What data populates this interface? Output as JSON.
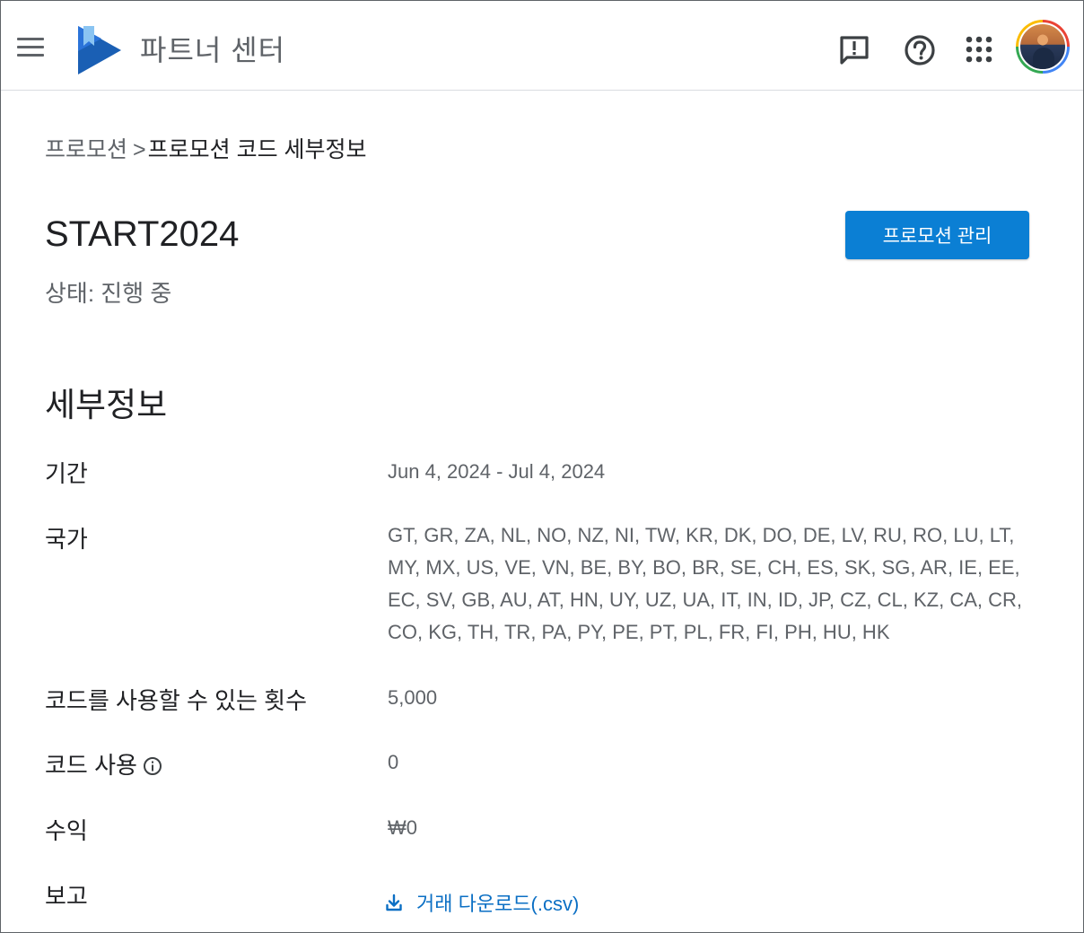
{
  "header": {
    "title": "파트너 센터",
    "icons": [
      "menu-icon",
      "play-books-logo",
      "feedback-icon",
      "help-icon",
      "apps-grid-icon",
      "avatar"
    ]
  },
  "breadcrumb": {
    "parent": "프로모션",
    "separator": ">",
    "current": "프로모션 코드 세부정보"
  },
  "promo": {
    "code": "START2024",
    "status": "상태: 진행 중",
    "manage_label": "프로모션 관리"
  },
  "details": {
    "title": "세부정보",
    "period_label": "기간",
    "period_value": "Jun 4, 2024 - Jul 4, 2024",
    "countries_label": "국가",
    "countries_value": "GT, GR, ZA, NL, NO, NZ, NI, TW, KR, DK, DO, DE, LV, RU, RO, LU, LT, MY, MX, US, VE, VN, BE, BY, BO, BR, SE, CH, ES, SK, SG, AR, IE, EE, EC, SV, GB, AU, AT, HN, UY, UZ, UA, IT, IN, ID, JP, CZ, CL, KZ, CA, CR, CO, KG, TH, TR, PA, PY, PE, PT, PL, FR, FI, PH, HU, HK",
    "uses_label": "코드를 사용할 수 있는 횟수",
    "uses_value": "5,000",
    "used_label": "코드 사용",
    "used_value": "0",
    "revenue_label": "수익",
    "revenue_value": "₩0",
    "report_label": "보고",
    "report_link": "거래 다운로드(.csv)"
  },
  "colors": {
    "primary": "#0b7fd4",
    "link": "#0b6fc4",
    "text": "#202124",
    "secondary_text": "#5f6368"
  }
}
